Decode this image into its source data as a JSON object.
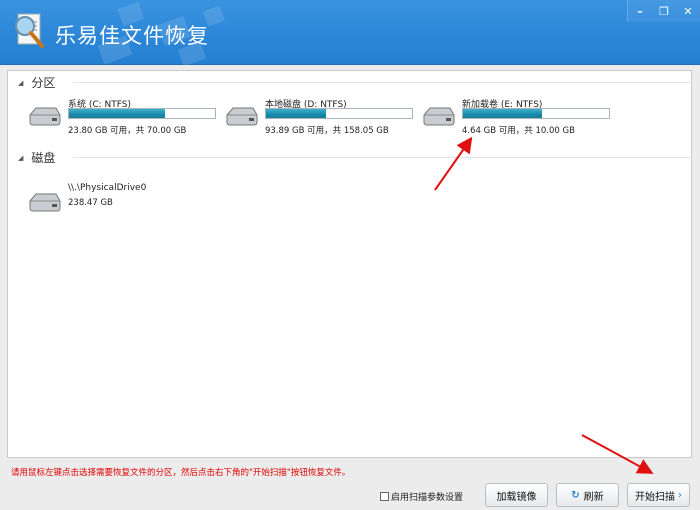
{
  "window": {
    "title": "乐易佳文件恢复",
    "minimize": "–",
    "restore": "❐",
    "close": "✕"
  },
  "groups": {
    "partitions": "分区",
    "disks": "磁盘"
  },
  "partitions": [
    {
      "name": "系统 (C: NTFS)",
      "caption": "23.80 GB 可用，共 70.00 GB",
      "used_fraction": 0.66
    },
    {
      "name": "本地磁盘 (D: NTFS)",
      "caption": "93.89 GB 可用，共 158.05 GB",
      "used_fraction": 0.41
    },
    {
      "name": "新加载卷 (E: NTFS)",
      "caption": "4.64 GB 可用，共 10.00 GB",
      "used_fraction": 0.54
    }
  ],
  "disks": [
    {
      "name": "\\\\.\\PhysicalDrive0",
      "caption": "238.47 GB"
    }
  ],
  "footer": {
    "hint": "请用鼠标左键点击选择需要恢复文件的分区，然后点击右下角的\"开始扫描\"按钮恢复文件。",
    "scan_settings": "启用扫描参数设置",
    "load_image": "加载镜像",
    "refresh_icon": "↻",
    "refresh": "刷新",
    "start_scan": "开始扫描",
    "start_arrow": "›"
  },
  "colors": {
    "titlebar": "#2b86d8",
    "hint": "#e00000",
    "annotation": "#e01010"
  }
}
